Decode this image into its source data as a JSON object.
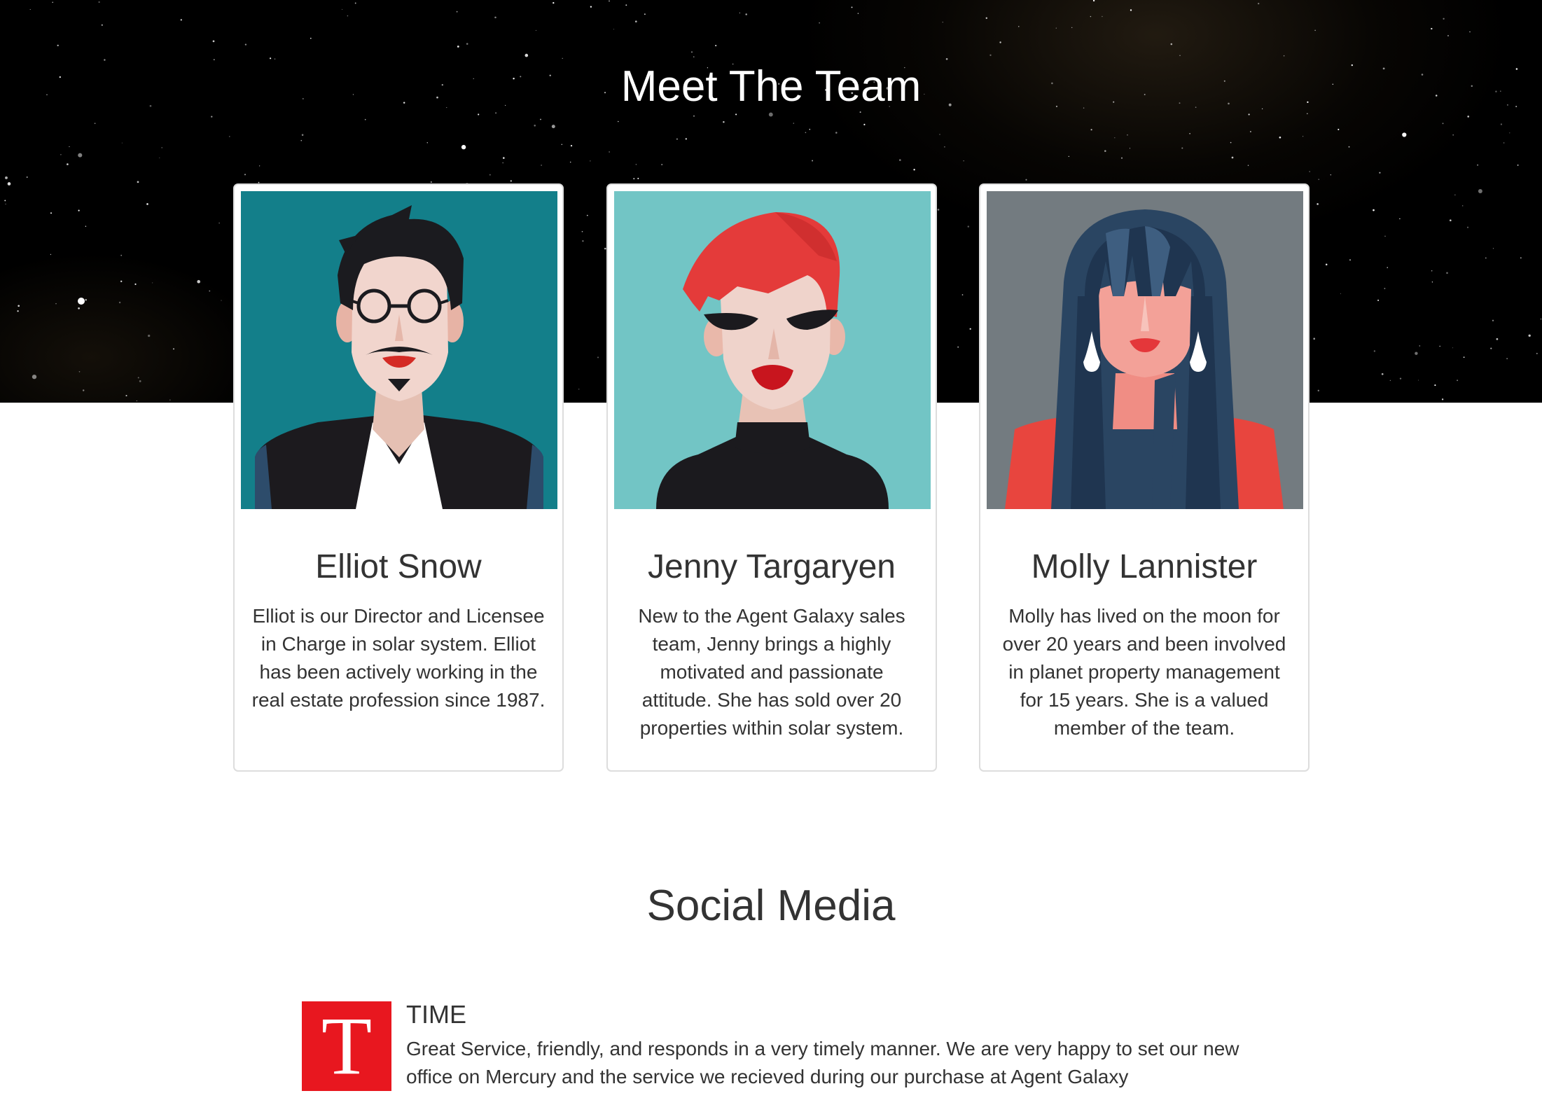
{
  "team": {
    "title": "Meet The Team",
    "members": [
      {
        "name": "Elliot Snow",
        "bio": "Elliot is our Director and Licensee in Charge in solar system. Elliot has been actively working in the real estate profession since 1987.",
        "avatar_icon": "man-with-glasses-avatar",
        "avatar_bg": "#137f8a"
      },
      {
        "name": "Jenny Targaryen",
        "bio": "New to the Agent Galaxy sales team, Jenny brings a highly motivated and passionate attitude. She has sold over 20 properties within solar system.",
        "avatar_icon": "red-haired-woman-sunglasses-avatar",
        "avatar_bg": "#72c5c5"
      },
      {
        "name": "Molly Lannister",
        "bio": "Molly has lived on the moon for over 20 years and been involved in planet property management for 15 years. She is a valued member of the team.",
        "avatar_icon": "long-haired-woman-earrings-avatar",
        "avatar_bg": "#737b80"
      }
    ]
  },
  "social": {
    "title": "Social Media",
    "testimonial": {
      "logo_letter": "T",
      "logo_color": "#e8171f",
      "source": "TIME",
      "text": "Great Service, friendly, and responds in a very timely manner. We are very happy to set our new office on Mercury and the service we recieved during our purchase at Agent Galaxy"
    }
  }
}
